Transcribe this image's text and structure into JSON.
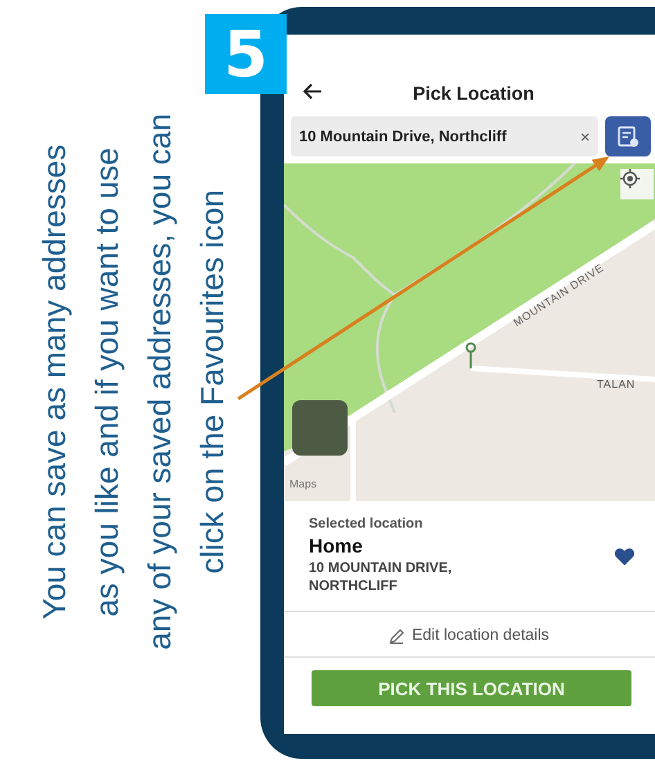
{
  "badge": {
    "number": "5"
  },
  "caption": "You can save as many addresses\nas you like and if you want to use\nany of your saved addresses, you can\nclick on the Favourites icon",
  "header": {
    "title": "Pick Location"
  },
  "search": {
    "value": "10 Mountain Drive, Northcliff",
    "clear": "×"
  },
  "map": {
    "street_labels": [
      "MOUNTAIN DRIVE",
      "TALAN"
    ],
    "attribution": "Maps"
  },
  "selected": {
    "label": "Selected location",
    "name": "Home",
    "address": "10 MOUNTAIN DRIVE, NORTHCLIFF",
    "favourite": true
  },
  "edit_link": "Edit location details",
  "button": "PICK THIS LOCATION"
}
